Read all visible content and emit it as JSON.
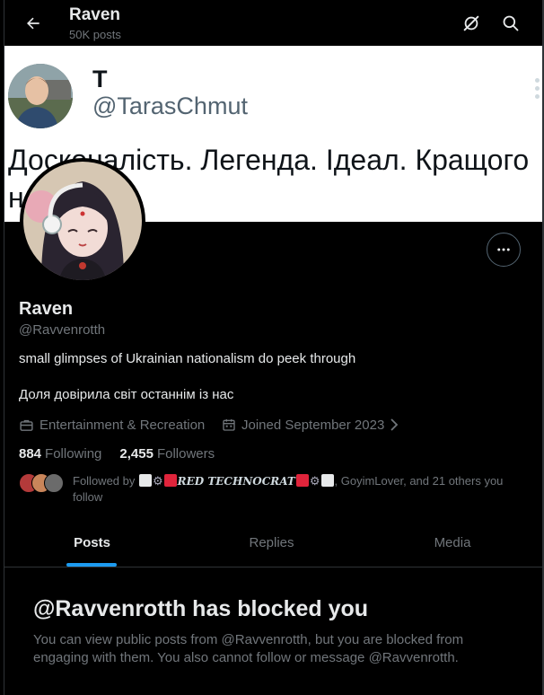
{
  "header": {
    "title": "Raven",
    "posts_count": "50K posts",
    "back_icon": "arrow-left-icon",
    "icons": [
      "circle-slash-icon",
      "search-icon"
    ]
  },
  "banner": {
    "name": "T",
    "handle": "@TarasChmut",
    "text_line1": "Досконалість. Легенда. Ідеал. Кращого",
    "text_line2": "н"
  },
  "profile": {
    "name": "Raven",
    "handle": "@Ravvenrotth",
    "bio_line1": "small glimpses of Ukrainian nationalism do peek through",
    "bio_line2": "Доля довірила світ останнім із нас",
    "category": "Entertainment & Recreation",
    "joined": "Joined September 2023",
    "following_count": "884",
    "following_label": "Following",
    "followers_count": "2,455",
    "followers_label": "Followers",
    "followed_by_prefix": "Followed by",
    "followed_by_name": "RED TECHNOCRAT",
    "followed_by_rest": ", GoyimLover, and 21 others you follow"
  },
  "tabs": [
    {
      "label": "Posts",
      "active": true
    },
    {
      "label": "Replies",
      "active": false
    },
    {
      "label": "Media",
      "active": false
    }
  ],
  "blocked": {
    "title": "@Ravvenrotth has blocked you",
    "message": "You can view public posts from @Ravvenrotth, but you are blocked from engaging with them. You also cannot follow or message @Ravvenrotth."
  },
  "colors": {
    "accent": "#1d9bf0",
    "background": "#000000",
    "muted": "#71767b",
    "text": "#e7e9ea"
  }
}
